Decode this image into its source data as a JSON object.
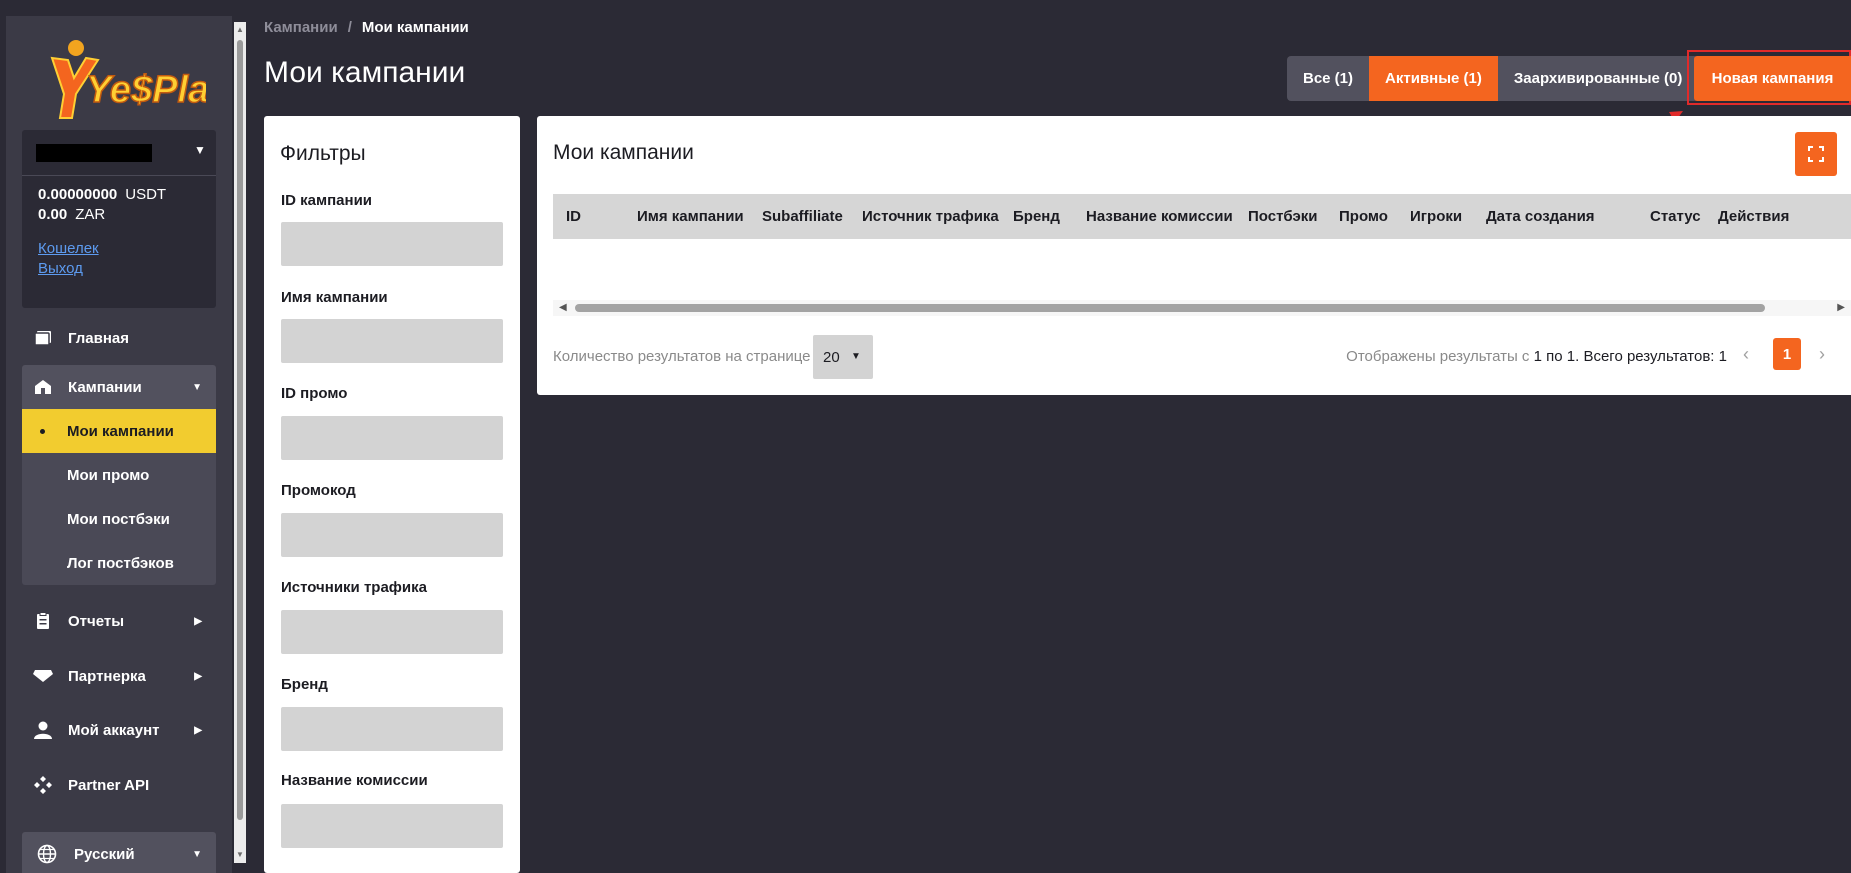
{
  "sidebar": {
    "logo_text": "Ye$Play",
    "user": {
      "balances": [
        {
          "amount": "0.00000000",
          "currency": "USDT"
        },
        {
          "amount": "0.00",
          "currency": "ZAR"
        }
      ],
      "wallet_link": "Кошелек",
      "logout_link": "Выход"
    },
    "nav": {
      "home": "Главная",
      "campaigns": "Кампании",
      "sub_items": [
        "Мои кампании",
        "Мои промо",
        "Мои постбэки",
        "Лог постбэков"
      ],
      "reports": "Отчеты",
      "partner": "Партнерка",
      "account": "Мой аккаунт",
      "api": "Partner API",
      "language": "Русский"
    }
  },
  "header": {
    "breadcrumb": {
      "parent": "Кампании",
      "separator": "/",
      "current": "Мои кампании"
    },
    "title": "Мои кампании",
    "tabs": [
      "Все (1)",
      "Активные (1)",
      "Заархивированные (0)"
    ],
    "active_tab": "Активные (1)",
    "new_campaign": "Новая кампания"
  },
  "filters": {
    "title": "Фильтры",
    "fields": [
      "ID кампании",
      "Имя кампании",
      "ID промо",
      "Промокод",
      "Источники трафика",
      "Бренд",
      "Название комиссии"
    ]
  },
  "table": {
    "title": "Мои кампании",
    "columns": [
      "ID",
      "Имя кампании",
      "Subaffiliate",
      "Источник трафика",
      "Бренд",
      "Название комиссии",
      "Постбэки",
      "Промо",
      "Игроки",
      "Дата создания",
      "Статус",
      "Действия"
    ],
    "per_page_label": "Количество результатов на странице",
    "per_page_value": "20",
    "results_prefix": "Отображены результаты с",
    "results_from": "1",
    "results_mid": "по",
    "results_to": "1.",
    "results_total_label": "Всего результатов:",
    "results_total": "1",
    "current_page": "1"
  },
  "colors": {
    "accent": "#f4651f",
    "highlight": "#f2cc2f",
    "sidebar_bg": "#3b3a46",
    "page_bg": "#2b2a35",
    "annotation_red": "#e22a2a"
  }
}
